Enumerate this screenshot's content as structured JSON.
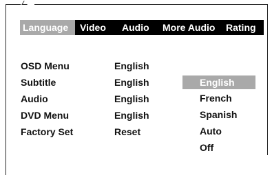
{
  "tabs": [
    {
      "label": "Language",
      "active": true
    },
    {
      "label": "Video",
      "active": false
    },
    {
      "label": "Audio",
      "active": false
    },
    {
      "label": "More Audio",
      "active": false
    },
    {
      "label": "Rating",
      "active": false
    }
  ],
  "settings": [
    {
      "label": "OSD Menu",
      "value": "English"
    },
    {
      "label": "Subtitle",
      "value": "English"
    },
    {
      "label": "Audio",
      "value": "English"
    },
    {
      "label": "DVD Menu",
      "value": "English"
    },
    {
      "label": "Factory Set",
      "value": "Reset"
    }
  ],
  "options": [
    {
      "label": "English",
      "selected": true
    },
    {
      "label": "French",
      "selected": false
    },
    {
      "label": "Spanish",
      "selected": false
    },
    {
      "label": "Auto",
      "selected": false
    },
    {
      "label": "Off",
      "selected": false
    }
  ],
  "colors": {
    "tab_bar": "#000000",
    "highlight": "#a9a9a9",
    "text": "#111111"
  }
}
